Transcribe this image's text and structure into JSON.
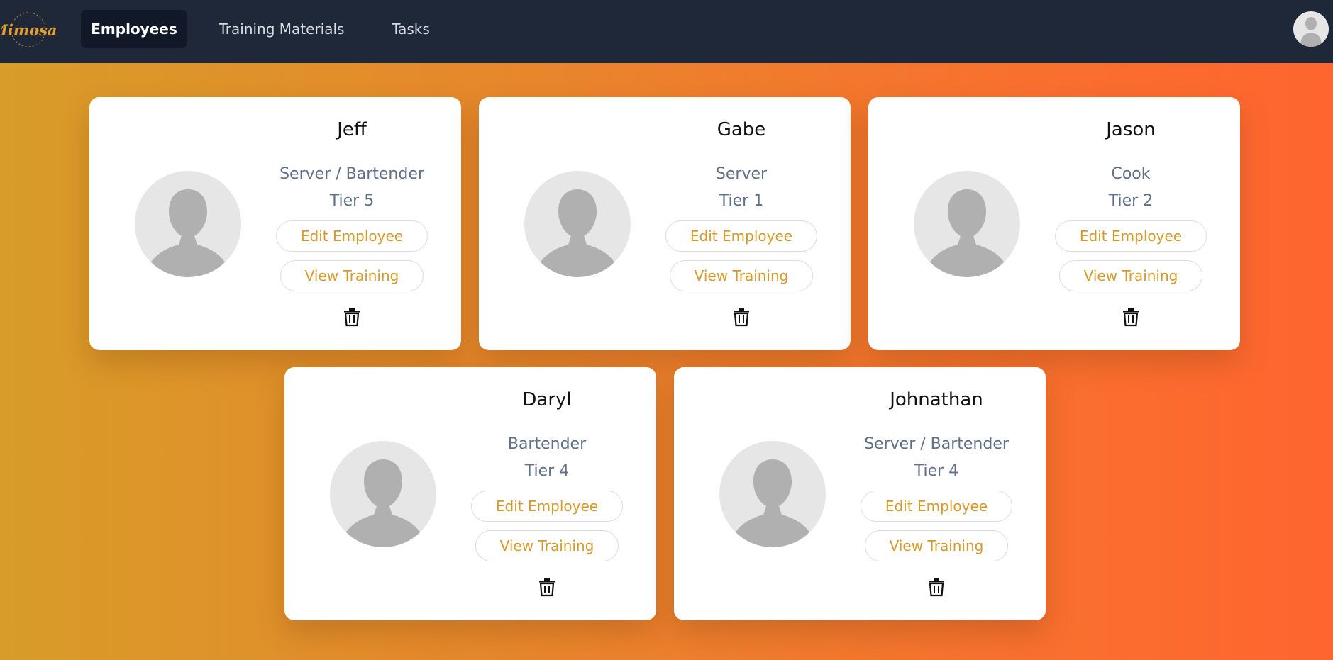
{
  "nav": {
    "tabs": [
      {
        "label": "Employees",
        "active": true
      },
      {
        "label": "Training Materials",
        "active": false
      },
      {
        "label": "Tasks",
        "active": false
      }
    ],
    "logo_text": "Mimosas",
    "profile_icon": "user-avatar-icon"
  },
  "employees": [
    {
      "name": "Jeff",
      "role": "Server / Bartender",
      "tier": "Tier 5",
      "edit_label": "Edit Employee",
      "training_label": "View Training"
    },
    {
      "name": "Gabe",
      "role": "Server",
      "tier": "Tier 1",
      "edit_label": "Edit Employee",
      "training_label": "View Training"
    },
    {
      "name": "Jason",
      "role": "Cook",
      "tier": "Tier 2",
      "edit_label": "Edit Employee",
      "training_label": "View Training"
    },
    {
      "name": "Daryl",
      "role": "Bartender",
      "tier": "Tier 4",
      "edit_label": "Edit Employee",
      "training_label": "View Training"
    },
    {
      "name": "Johnathan",
      "role": "Server / Bartender",
      "tier": "Tier 4",
      "edit_label": "Edit Employee",
      "training_label": "View Training"
    }
  ],
  "colors": {
    "nav_bg": "#1f2838",
    "accent": "#d69a2a",
    "muted_text": "#5f6f88",
    "gradient_start": "#d89c28",
    "gradient_end": "#ff652f"
  }
}
